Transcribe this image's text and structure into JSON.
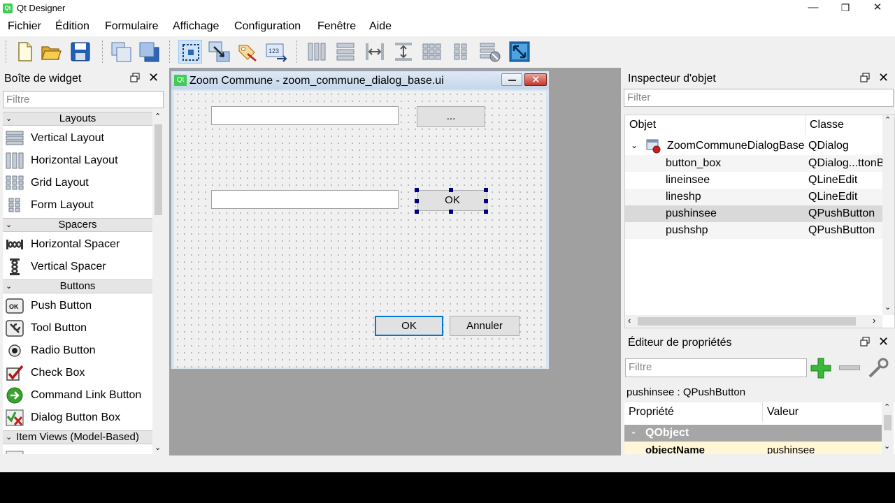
{
  "window": {
    "title": "Qt Designer",
    "logo": "Qt",
    "minimize_icon": "—",
    "restore_icon": "❐",
    "close_icon": "✕"
  },
  "menu": [
    "Fichier",
    "Édition",
    "Formulaire",
    "Affichage",
    "Configuration",
    "Fenêtre",
    "Aide"
  ],
  "toolbar_icons": [
    "new-file-icon",
    "open-folder-icon",
    "save-icon",
    "bring-to-front-icon",
    "send-to-back-icon",
    "edit-widgets-icon",
    "edit-signals-slots-icon",
    "edit-buddies-icon",
    "edit-tab-order-icon",
    "layout-horizontal-icon",
    "layout-vertical-icon",
    "layout-horizontal-splitter-icon",
    "layout-vertical-splitter-icon",
    "layout-grid-icon",
    "layout-form-icon",
    "break-layout-icon",
    "adjust-size-icon"
  ],
  "widget_box": {
    "title": "Boîte de widget",
    "filter_placeholder": "Filtre",
    "categories": {
      "layouts": "Layouts",
      "spacers": "Spacers",
      "buttons": "Buttons",
      "item_views": "Item Views (Model-Based)"
    },
    "items": {
      "vertical_layout": "Vertical Layout",
      "horizontal_layout": "Horizontal Layout",
      "grid_layout": "Grid Layout",
      "form_layout": "Form Layout",
      "horizontal_spacer": "Horizontal Spacer",
      "vertical_spacer": "Vertical Spacer",
      "push_button": "Push Button",
      "tool_button": "Tool Button",
      "radio_button": "Radio Button",
      "check_box": "Check Box",
      "command_link_button": "Command Link Button",
      "dialog_button_box": "Dialog Button Box"
    },
    "ok_icon_text": "OK"
  },
  "form": {
    "title": "Zoom Commune - zoom_commune_dialog_base.ui",
    "logo": "Qt",
    "browse_label": "...",
    "ok_inner_label": "OK",
    "ok_label": "OK",
    "cancel_label": "Annuler"
  },
  "object_inspector": {
    "title": "Inspecteur d'objet",
    "filter_placeholder": "Filter",
    "col_object": "Objet",
    "col_class": "Classe",
    "rows": [
      {
        "object": "ZoomCommuneDialogBase",
        "class": "QDialog"
      },
      {
        "object": "button_box",
        "class": "QDialog...ttonB"
      },
      {
        "object": "lineinsee",
        "class": "QLineEdit"
      },
      {
        "object": "lineshp",
        "class": "QLineEdit"
      },
      {
        "object": "pushinsee",
        "class": "QPushButton"
      },
      {
        "object": "pushshp",
        "class": "QPushButton"
      }
    ]
  },
  "property_editor": {
    "title": "Éditeur de propriétés",
    "filter_placeholder": "Filtre",
    "current": "pushinsee : QPushButton",
    "col_property": "Propriété",
    "col_value": "Valeur",
    "group": "QObject",
    "prop_name": "objectName",
    "prop_value": "pushinsee"
  },
  "colors": {
    "accent": "#0078d7",
    "handle": "#000080",
    "qt_green": "#41cd52"
  }
}
